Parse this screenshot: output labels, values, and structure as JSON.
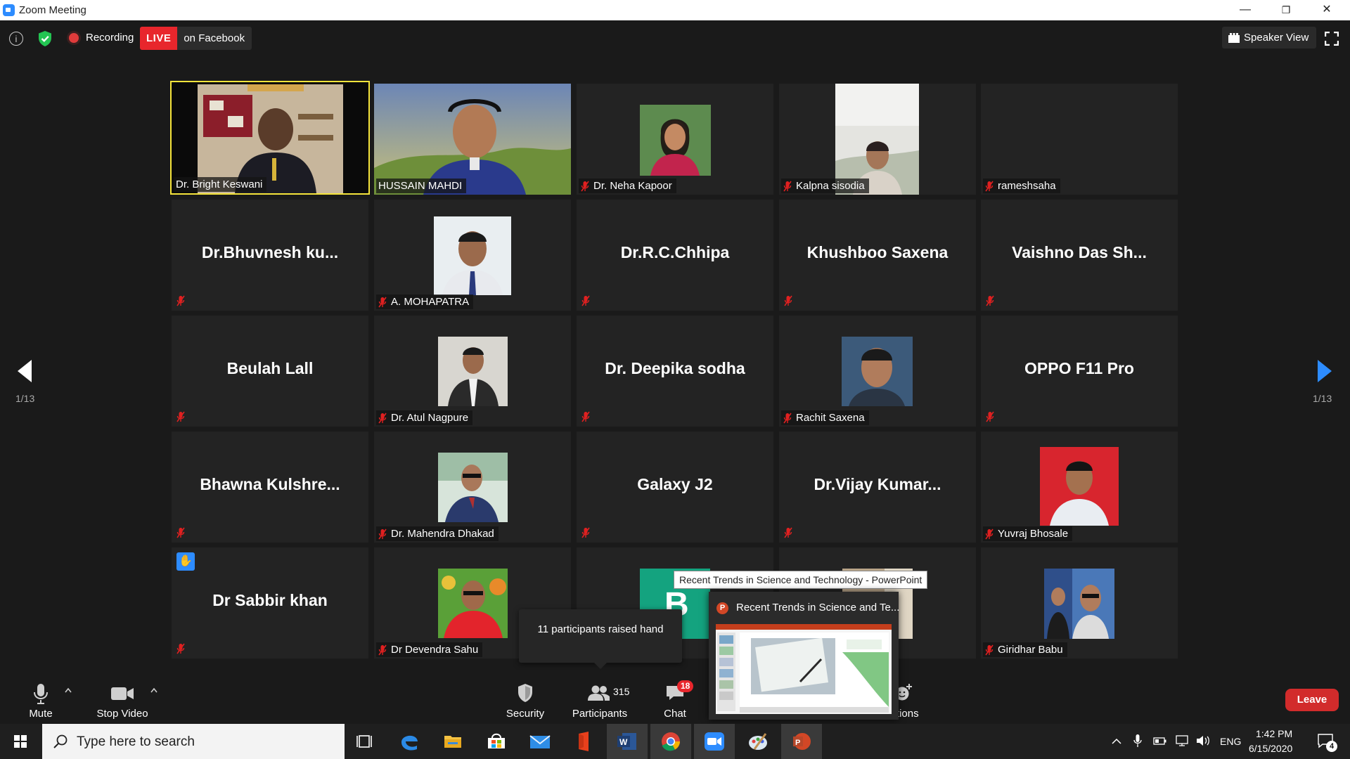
{
  "window": {
    "title": "Zoom Meeting",
    "minimize": "—",
    "restore": "❐",
    "close": "✕"
  },
  "topbar": {
    "info": "i",
    "recording_label": "Recording",
    "live_badge": "LIVE",
    "live_platform": "on Facebook",
    "view_label": "Speaker View"
  },
  "gallery": {
    "page_label_left": "1/13",
    "page_label_right": "1/13",
    "tiles": [
      {
        "name": "Dr. Bright Keswani",
        "video": true,
        "active": true
      },
      {
        "name": "HUSSAIN MAHDI",
        "video": true
      },
      {
        "name": "Dr. Neha Kapoor",
        "video": true,
        "muted": true
      },
      {
        "name": "Kalpna sisodia",
        "video": true,
        "muted": true
      },
      {
        "name": "rameshsaha",
        "muted": true
      },
      {
        "display": "Dr.Bhuvnesh  ku...",
        "muted": true
      },
      {
        "name": "A. MOHAPATRA",
        "video": true,
        "muted": true
      },
      {
        "display": "Dr.R.C.Chhipa",
        "muted": true
      },
      {
        "display": "Khushboo Saxena",
        "muted": true
      },
      {
        "display": "Vaishno Das Sh...",
        "muted": true
      },
      {
        "display": "Beulah Lall",
        "muted": true
      },
      {
        "name": "Dr. Atul Nagpure",
        "video": true,
        "muted": true
      },
      {
        "display": "Dr. Deepika sodha",
        "muted": true
      },
      {
        "name": "Rachit Saxena",
        "video": true,
        "muted": true
      },
      {
        "display": "OPPO F11 Pro",
        "muted": true
      },
      {
        "display": "Bhawna  Kulshre...",
        "muted": true
      },
      {
        "name": "Dr. Mahendra Dhakad",
        "video": true,
        "muted": true
      },
      {
        "display": "Galaxy J2",
        "muted": true
      },
      {
        "display": "Dr.Vijay  Kumar...",
        "muted": true
      },
      {
        "name": "Yuvraj Bhosale",
        "video": true,
        "muted": true
      },
      {
        "display": "Dr Sabbir khan",
        "muted": true,
        "hand_raised": true
      },
      {
        "name": "Dr Devendra Sahu",
        "video": true,
        "muted": true
      },
      {
        "avatar_letter": "B"
      },
      {},
      {
        "name": "Giridhar Babu",
        "video": true,
        "muted": true
      }
    ]
  },
  "tooltips": {
    "raised_hand": "11 participants raised hand",
    "window_title": "Recent Trends in Science and Technology - PowerPoint",
    "preview_title": "Recent Trends in Science and Te..."
  },
  "toolbar": {
    "mute": "Mute",
    "stop_video": "Stop Video",
    "security": "Security",
    "participants": "Participants",
    "participants_count": "315",
    "chat": "Chat",
    "chat_count": "18",
    "reactions": "ctions",
    "leave": "Leave"
  },
  "taskbar": {
    "search_placeholder": "Type here to search",
    "lang": "ENG",
    "time": "1:42 PM",
    "date": "6/15/2020",
    "notification_count": "4"
  },
  "colors": {
    "active_speaker": "#f5e43b",
    "live_red": "#e8262c",
    "zoom_blue": "#2d8cff",
    "leave_red": "#d22b2b",
    "tile_bg": "#232323"
  }
}
